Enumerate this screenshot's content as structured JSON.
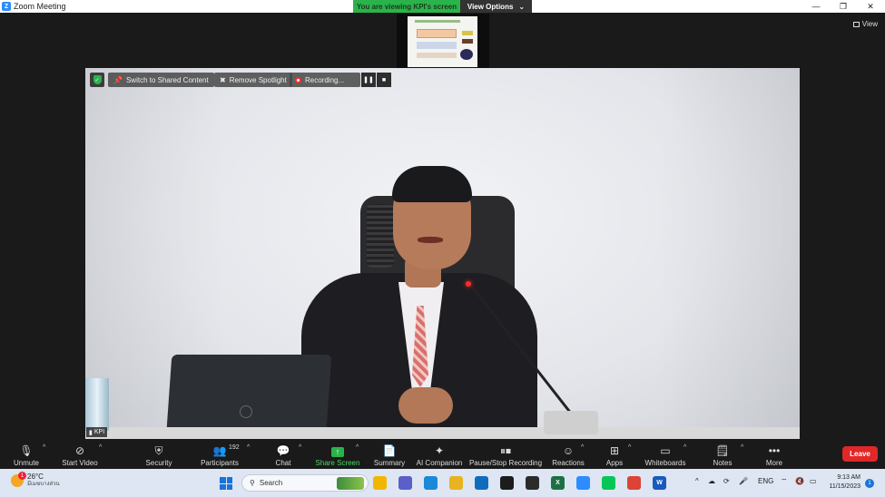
{
  "titlebar": {
    "logo": "Z",
    "title": "Zoom Meeting",
    "viewing_banner": "You are viewing KPI's screen",
    "view_options": "View Options",
    "view_options_icon": "chevron-down-icon"
  },
  "window_controls": {
    "minimize": "—",
    "restore": "❐",
    "close": "✕"
  },
  "stage": {
    "view_label": "View"
  },
  "video_overlay": {
    "switch_to_shared": "Switch to Shared Content",
    "remove_spotlight": "Remove Spotlight",
    "recording": "Recording...",
    "pause_glyph": "❚❚",
    "stop_glyph": "■",
    "participant_name": "KPI"
  },
  "toolbar": {
    "unmute": "Unmute",
    "start_video": "Start Video",
    "security": "Security",
    "participants": "Participants",
    "participants_count": "192",
    "chat": "Chat",
    "share_screen": "Share Screen",
    "summary": "Summary",
    "ai_companion": "AI Companion",
    "pause_stop_recording": "Pause/Stop Recording",
    "reactions": "Reactions",
    "apps": "Apps",
    "whiteboards": "Whiteboards",
    "notes": "Notes",
    "more": "More",
    "leave": "Leave",
    "caret": "^"
  },
  "taskbar": {
    "temperature": "26°C",
    "weather_desc": "มีเมฆบางส่วน",
    "weather_badge": "1",
    "search_placeholder": "Search",
    "language": "ENG",
    "time": "9:13 AM",
    "date": "11/15/2023",
    "notification_count": "1",
    "tray_chevron": "^",
    "apps": [
      {
        "name": "file-explorer-icon",
        "color": "#f2b600",
        "glyph": ""
      },
      {
        "name": "teams-icon",
        "color": "#5b5fc7",
        "glyph": ""
      },
      {
        "name": "edge-icon",
        "color": "#1b88d9",
        "glyph": ""
      },
      {
        "name": "folder-icon",
        "color": "#e8b321",
        "glyph": ""
      },
      {
        "name": "mail-icon",
        "color": "#0f6cbd",
        "glyph": ""
      },
      {
        "name": "dell-icon",
        "color": "#1c1c1c",
        "glyph": ""
      },
      {
        "name": "sticky-notes-icon",
        "color": "#2b2b2b",
        "glyph": ""
      },
      {
        "name": "excel-icon",
        "color": "#1d7044",
        "glyph": "X"
      },
      {
        "name": "zoom-icon",
        "color": "#2d8cff",
        "glyph": ""
      },
      {
        "name": "line-icon",
        "color": "#06c755",
        "glyph": ""
      },
      {
        "name": "chrome-icon",
        "color": "#db4437",
        "glyph": ""
      },
      {
        "name": "word-icon",
        "color": "#185abd",
        "glyph": "W"
      }
    ]
  },
  "colors": {
    "accent_green": "#2bb34b",
    "leave_red": "#e02828",
    "zoom_blue": "#2d8cff"
  }
}
